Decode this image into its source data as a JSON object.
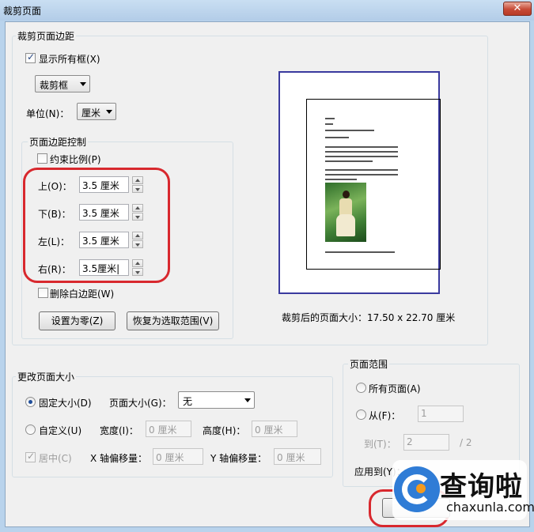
{
  "window": {
    "title": "裁剪页面",
    "close_symbol": "✕"
  },
  "margins_group": {
    "title": "裁剪页面边距",
    "show_all_boxes": {
      "label": "显示所有框(X)",
      "checked": true
    },
    "box_select": {
      "value": "裁剪框"
    },
    "unit": {
      "label": "单位(N)：",
      "value": "厘米"
    }
  },
  "margin_controls": {
    "title": "页面边距控制",
    "constrain": {
      "label": "约束比例(P)",
      "checked": false
    },
    "top": {
      "label": "上(O)：",
      "value": "3.5 厘米"
    },
    "bottom": {
      "label": "下(B)：",
      "value": "3.5 厘米"
    },
    "left": {
      "label": "左(L)：",
      "value": "3.5 厘米"
    },
    "right": {
      "label": "右(R)：",
      "value": "3.5厘米|"
    },
    "remove_white": {
      "label": "删除白边距(W)",
      "checked": false
    },
    "set_zero_button": "设置为零(Z)",
    "revert_button": "恢复为选取范围(V)"
  },
  "preview": {
    "size_label": "裁剪后的页面大小：17.50 x 22.70 厘米"
  },
  "change_size_group": {
    "title": "更改页面大小",
    "fixed_size": {
      "label": "固定大小(D)",
      "selected": true
    },
    "page_size": {
      "label": "页面大小(G)：",
      "value": "无"
    },
    "custom": {
      "label": "自定义(U)",
      "selected": false
    },
    "width": {
      "label": "宽度(I)：",
      "value": "0 厘米"
    },
    "height": {
      "label": "高度(H)：",
      "value": "0 厘米"
    },
    "center": {
      "label": "居中(C)",
      "checked": true
    },
    "x_offset": {
      "label": "X 轴偏移量：",
      "value": "0 厘米"
    },
    "y_offset": {
      "label": "Y 轴偏移量：",
      "value": "0 厘米"
    }
  },
  "page_range_group": {
    "title": "页面范围",
    "all_pages": {
      "label": "所有页面(A)",
      "selected": false
    },
    "from": {
      "label": "从(F)：",
      "value": "1",
      "selected": false
    },
    "to": {
      "label": "到(T)：",
      "value": "2",
      "of": "/ 2"
    },
    "apply_to": {
      "label": "应用到(Y)："
    }
  },
  "watermark": {
    "cn": "查询啦",
    "en": "chaxunla.com"
  },
  "colors": {
    "highlight": "#d8282e",
    "preview_border": "#3a3a9e"
  }
}
